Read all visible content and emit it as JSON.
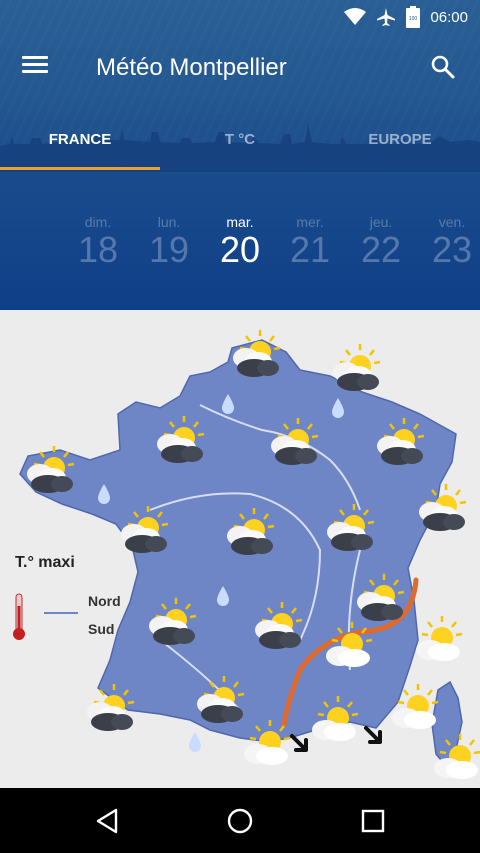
{
  "status": {
    "time": "06:00",
    "battery": "100"
  },
  "app": {
    "title": "Météo Montpellier"
  },
  "tabs": [
    {
      "label": "FRANCE",
      "active": true
    },
    {
      "label": "T °C",
      "active": false
    },
    {
      "label": "EUROPE",
      "active": false
    }
  ],
  "days": [
    {
      "name": "dim.",
      "num": "18"
    },
    {
      "name": "lun.",
      "num": "19"
    },
    {
      "name": "mar.",
      "num": "20",
      "active": true
    },
    {
      "name": "mer.",
      "num": "21"
    },
    {
      "name": "jeu.",
      "num": "22"
    },
    {
      "name": "ven.",
      "num": "23"
    }
  ],
  "legend": {
    "title": "T.° maxi",
    "nord": "Nord",
    "sud": "Sud"
  },
  "colors": {
    "accent": "#e8a233",
    "header": "#0f3f88",
    "map_land": "#6f86c6",
    "front": "#e06a2c"
  },
  "map_icons": [
    "partly-cloudy-icon",
    "rain-drop-icon",
    "cold-front-arrow-icon",
    "thermometer-icon"
  ]
}
